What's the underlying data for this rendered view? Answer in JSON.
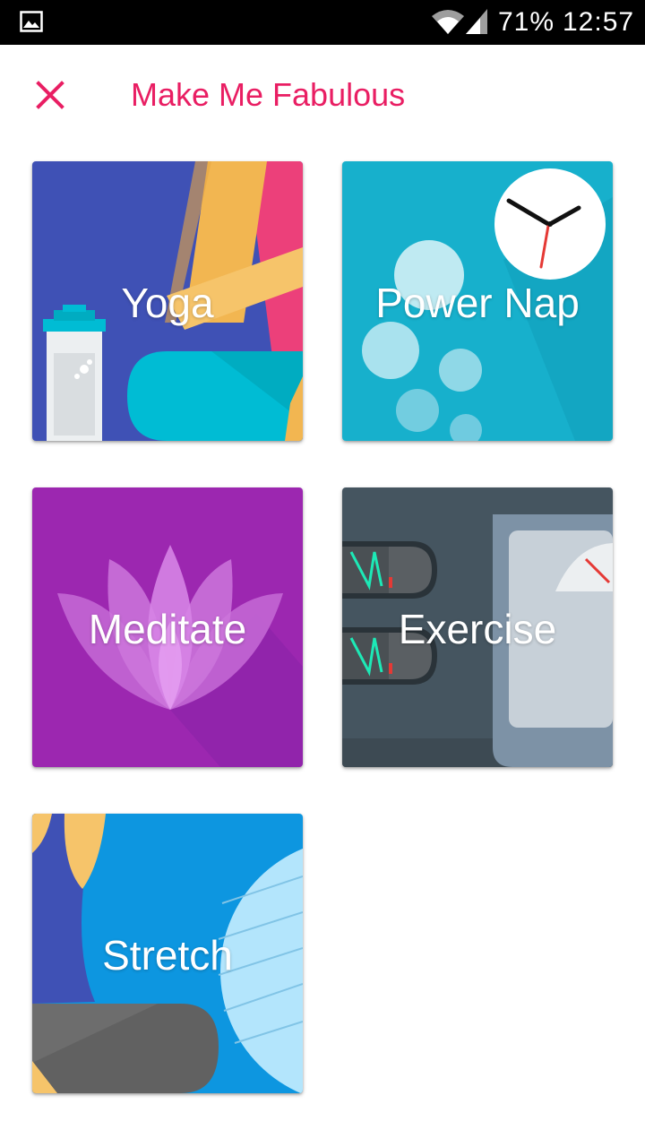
{
  "status_bar": {
    "battery": "71%",
    "time": "12:57",
    "icons": [
      "gallery-icon",
      "wifi-icon",
      "signal-icon"
    ]
  },
  "header": {
    "title": "Make Me Fabulous",
    "close_icon": "close-icon"
  },
  "cards": [
    {
      "label": "Yoga",
      "color": "#3f51b5"
    },
    {
      "label": "Power Nap",
      "color": "#17b0cc"
    },
    {
      "label": "Meditate",
      "color": "#9c27b0"
    },
    {
      "label": "Exercise",
      "color": "#455560"
    },
    {
      "label": "Stretch",
      "color": "#0d96e0"
    }
  ],
  "colors": {
    "accent": "#e91e63",
    "background": "#ffffff",
    "status_bar": "#000000"
  }
}
